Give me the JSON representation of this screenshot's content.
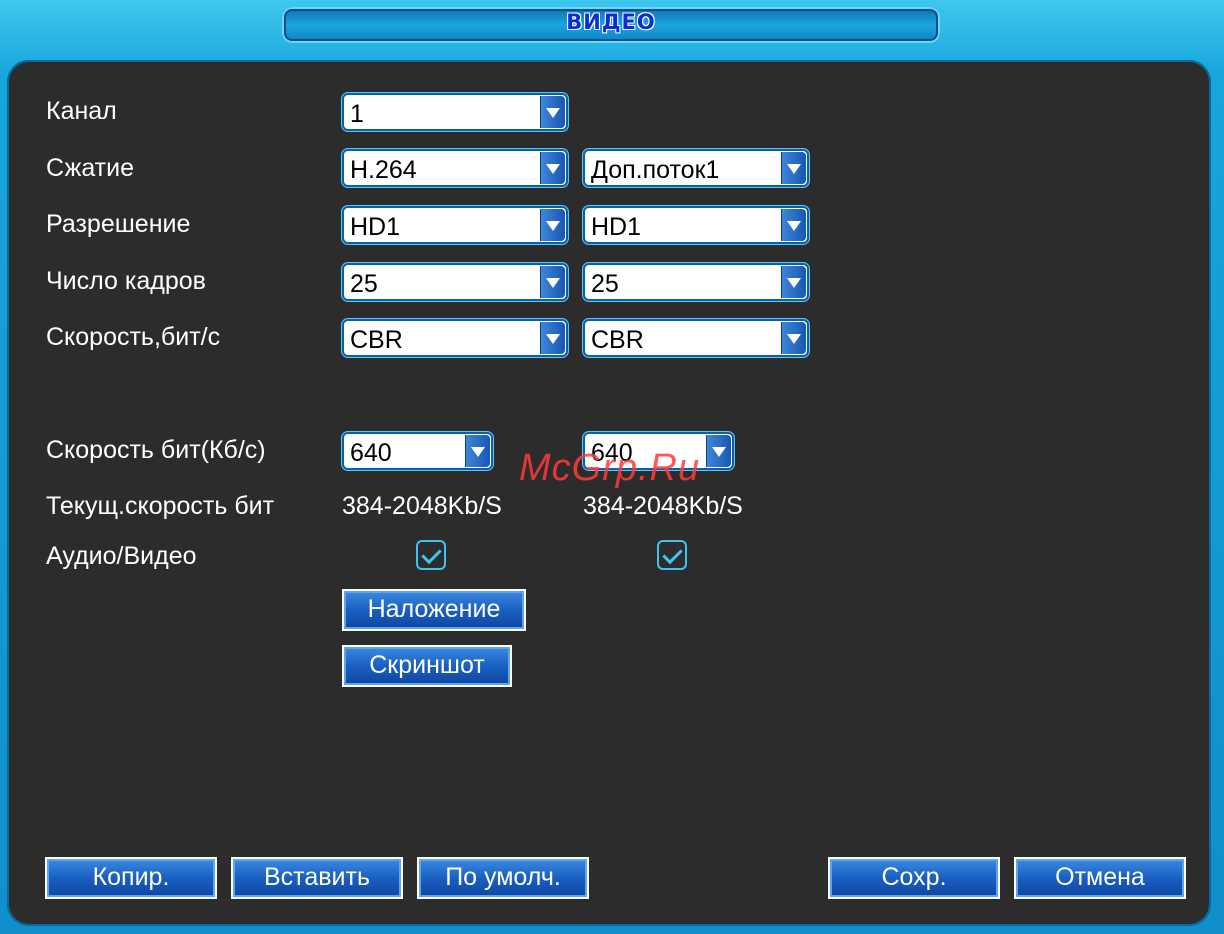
{
  "title": "ВИДЕО",
  "rows": {
    "channel": {
      "label": "Канал",
      "value": "1"
    },
    "compression": {
      "label": "Сжатие",
      "main": "H.264",
      "extra": "Доп.поток1"
    },
    "resolution": {
      "label": "Разрешение",
      "main": "HD1",
      "extra": "HD1"
    },
    "framerate": {
      "label": "Число кадров",
      "main": "25",
      "extra": "25"
    },
    "bitrate_type": {
      "label": "Скорость,бит/с",
      "main": "CBR",
      "extra": "CBR"
    },
    "bitrate": {
      "label": "Скорость бит(Кб/с)",
      "main": "640",
      "extra": "640"
    },
    "current_bitrate": {
      "label": "Текущ.скорость бит",
      "main": "384-2048Kb/S",
      "extra": "384-2048Kb/S"
    },
    "audio_video": {
      "label": "Аудио/Видео",
      "main_checked": true,
      "extra_checked": true
    }
  },
  "buttons": {
    "overlay": "Наложение",
    "snapshot": "Скриншот",
    "copy": "Копир.",
    "paste": "Вставить",
    "default": "По умолч.",
    "save": "Сохр.",
    "cancel": "Отмена"
  },
  "watermark": "McGrp.Ru"
}
